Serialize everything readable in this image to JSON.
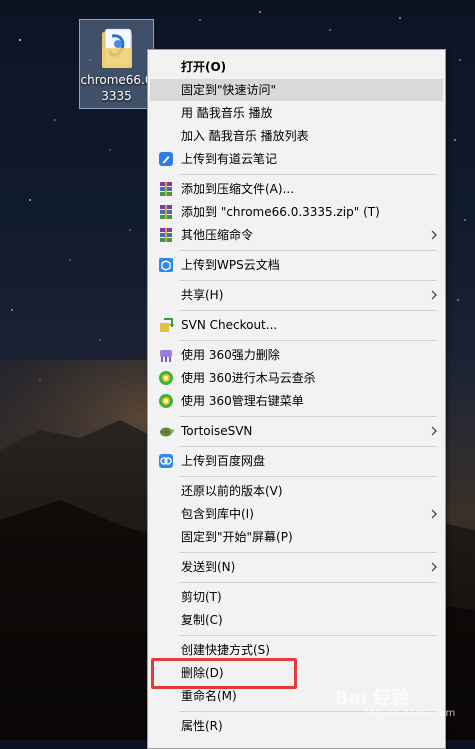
{
  "desktop_icon": {
    "label": "chrome66.0\n3335"
  },
  "menu": {
    "items": [
      {
        "label": "打开(O)"
      },
      {
        "label": "固定到\"快速访问\""
      },
      {
        "label": "用 酷我音乐 播放"
      },
      {
        "label": "加入 酷我音乐 播放列表"
      },
      {
        "label": "上传到有道云笔记"
      },
      {
        "label": "添加到压缩文件(A)..."
      },
      {
        "label": "添加到 \"chrome66.0.3335.zip\" (T)"
      },
      {
        "label": "其他压缩命令"
      },
      {
        "label": "上传到WPS云文档"
      },
      {
        "label": "共享(H)"
      },
      {
        "label": "SVN Checkout..."
      },
      {
        "label": "使用 360强力删除"
      },
      {
        "label": "使用 360进行木马云查杀"
      },
      {
        "label": "使用 360管理右键菜单"
      },
      {
        "label": "TortoiseSVN"
      },
      {
        "label": "上传到百度网盘"
      },
      {
        "label": "还原以前的版本(V)"
      },
      {
        "label": "包含到库中(I)"
      },
      {
        "label": "固定到\"开始\"屏幕(P)"
      },
      {
        "label": "发送到(N)"
      },
      {
        "label": "剪切(T)"
      },
      {
        "label": "复制(C)"
      },
      {
        "label": "创建快捷方式(S)"
      },
      {
        "label": "删除(D)"
      },
      {
        "label": "重命名(M)"
      },
      {
        "label": "属性(R)"
      }
    ]
  },
  "watermark": {
    "text": "Bai 经验",
    "sub": "jingyan.baidu.com"
  }
}
